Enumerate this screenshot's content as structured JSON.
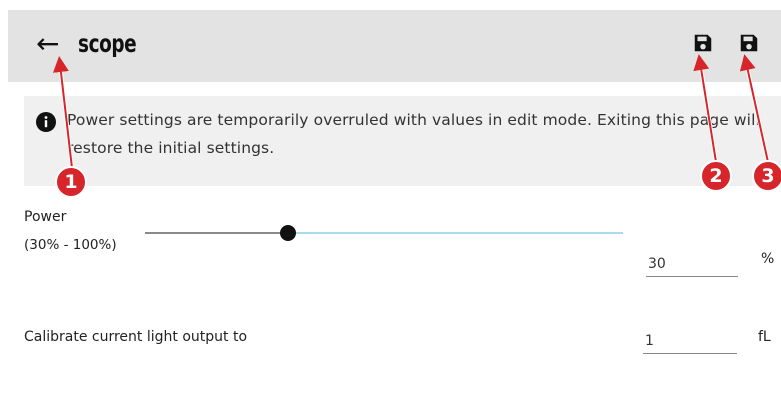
{
  "header": {
    "back_glyph": "←",
    "title": "scope",
    "icons": [
      "arrow-left-icon",
      "save-icon",
      "save-icon"
    ]
  },
  "info": {
    "icon": "info-icon",
    "message": "Power settings are temporarily overruled with values in edit mode. Exiting this page will restore the initial settings."
  },
  "power": {
    "label": "Power",
    "range": "(30% - 100%)",
    "value": "30",
    "unit": "%",
    "slider_fraction": 0.3
  },
  "calibrate": {
    "label": "Calibrate current light output to",
    "value": "1",
    "unit": "fL"
  },
  "callouts": [
    "1",
    "2",
    "3"
  ],
  "colors": {
    "header_bg": "#e3e3e3",
    "info_bg": "#f0f0f0",
    "slider_active": "#a9dcec",
    "callout_red": "#d7262b"
  }
}
